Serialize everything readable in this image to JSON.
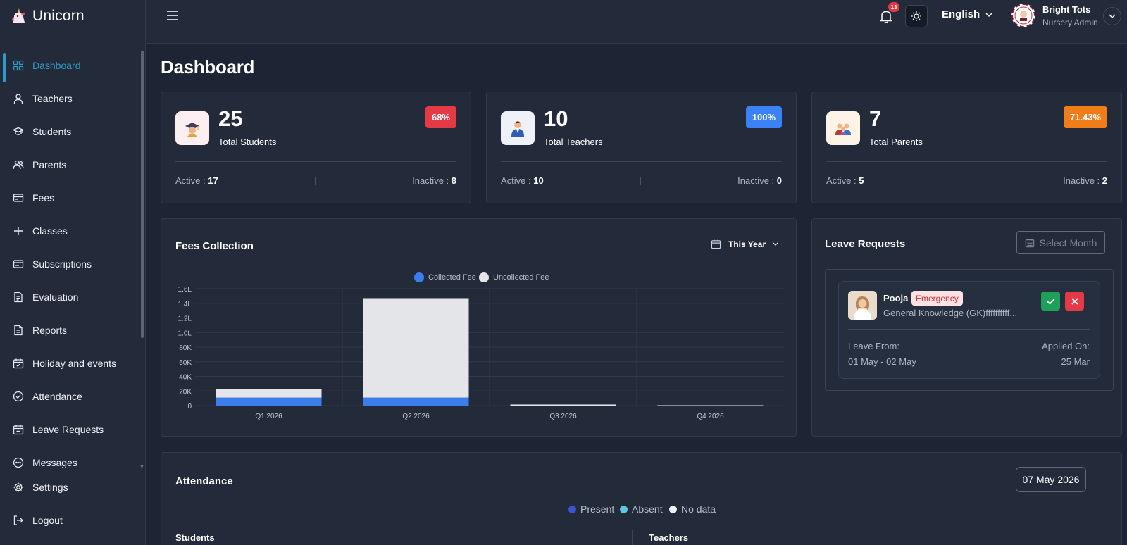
{
  "app": {
    "name": "Unicorn"
  },
  "sidebar": {
    "items": [
      {
        "label": "Dashboard",
        "icon": "grid-icon",
        "active": true
      },
      {
        "label": "Teachers",
        "icon": "user-icon"
      },
      {
        "label": "Students",
        "icon": "graduation-cap-icon"
      },
      {
        "label": "Parents",
        "icon": "users-icon"
      },
      {
        "label": "Fees",
        "icon": "credit-card-icon"
      },
      {
        "label": "Classes",
        "icon": "plus-icon"
      },
      {
        "label": "Subscriptions",
        "icon": "card-icon"
      },
      {
        "label": "Evaluation",
        "icon": "clipboard-icon"
      },
      {
        "label": "Reports",
        "icon": "document-icon"
      },
      {
        "label": "Holiday and events",
        "icon": "calendar-check-icon"
      },
      {
        "label": "Attendance",
        "icon": "check-circle-icon"
      },
      {
        "label": "Leave Requests",
        "icon": "calendar-leave-icon"
      },
      {
        "label": "Messages",
        "icon": "message-icon"
      }
    ],
    "bottom": [
      {
        "label": "Settings",
        "icon": "gear-icon"
      },
      {
        "label": "Logout",
        "icon": "logout-icon"
      }
    ],
    "active_color": "#2d9cc4"
  },
  "topbar": {
    "notification_count": "13",
    "language": "English",
    "user_name": "Bright Tots",
    "user_role": "Nursery Admin"
  },
  "page": {
    "title": "Dashboard"
  },
  "stats": [
    {
      "value": "25",
      "label": "Total Students",
      "badge": "68%",
      "badge_color": "#e53946",
      "active_label": "Active : ",
      "active": "17",
      "inactive_label": "Inactive : ",
      "inactive": "8",
      "icon": "student-icon"
    },
    {
      "value": "10",
      "label": "Total Teachers",
      "badge": "100%",
      "badge_color": "#3b82f6",
      "active_label": "Active : ",
      "active": "10",
      "inactive_label": "Inactive : ",
      "inactive": "0",
      "icon": "teacher-icon"
    },
    {
      "value": "7",
      "label": "Total Parents",
      "badge": "71.43%",
      "badge_color": "#f07c1a",
      "active_label": "Active : ",
      "active": "5",
      "inactive_label": "Inactive : ",
      "inactive": "2",
      "icon": "parents-icon"
    }
  ],
  "fees": {
    "title": "Fees Collection",
    "period": "This Year"
  },
  "chart_data": {
    "type": "bar",
    "stacked": true,
    "categories": [
      "Q1 2026",
      "Q2 2026",
      "Q3 2026",
      "Q4 2026"
    ],
    "series": [
      {
        "name": "Collected Fee",
        "color": "#3b7ded",
        "values": [
          11000,
          11000,
          0,
          0
        ]
      },
      {
        "name": "Uncollected Fee",
        "color": "#e4e5e9",
        "values": [
          12000,
          136000,
          1500,
          500
        ]
      }
    ],
    "yticks": [
      "0",
      "20K",
      "40K",
      "60K",
      "80K",
      "1.0L",
      "1.2L",
      "1.4L",
      "1.6L"
    ],
    "ylim": [
      0,
      160000
    ],
    "legend": "top-center",
    "grid": true
  },
  "leave": {
    "title": "Leave Requests",
    "month_placeholder": "Select Month",
    "request": {
      "name": "Pooja",
      "tag": "Emergency",
      "desc": "General Knowledge (GK)ffffffffff...",
      "from_label": "Leave From:",
      "from": "01 May - 02 May",
      "applied_label": "Applied On:",
      "applied": "25 Mar"
    }
  },
  "attendance": {
    "title": "Attendance",
    "date": "07 May 2026",
    "legend": [
      {
        "label": "Present",
        "color": "#3b54d6"
      },
      {
        "label": "Absent",
        "color": "#5ec8dc"
      },
      {
        "label": "No data",
        "color": "#eef0f4"
      }
    ],
    "students_label": "Students",
    "teachers_label": "Teachers"
  }
}
